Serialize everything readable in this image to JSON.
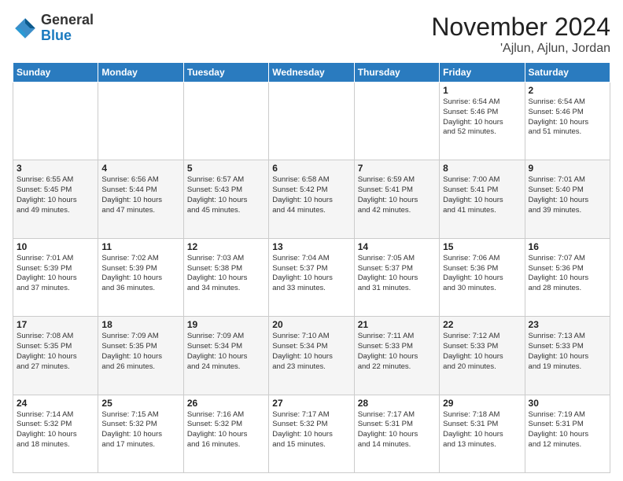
{
  "logo": {
    "general": "General",
    "blue": "Blue"
  },
  "header": {
    "title": "November 2024",
    "subtitle": "'Ajlun, Ajlun, Jordan"
  },
  "days_of_week": [
    "Sunday",
    "Monday",
    "Tuesday",
    "Wednesday",
    "Thursday",
    "Friday",
    "Saturday"
  ],
  "weeks": [
    [
      {
        "day": "",
        "info": ""
      },
      {
        "day": "",
        "info": ""
      },
      {
        "day": "",
        "info": ""
      },
      {
        "day": "",
        "info": ""
      },
      {
        "day": "",
        "info": ""
      },
      {
        "day": "1",
        "info": "Sunrise: 6:54 AM\nSunset: 5:46 PM\nDaylight: 10 hours\nand 52 minutes."
      },
      {
        "day": "2",
        "info": "Sunrise: 6:54 AM\nSunset: 5:46 PM\nDaylight: 10 hours\nand 51 minutes."
      }
    ],
    [
      {
        "day": "3",
        "info": "Sunrise: 6:55 AM\nSunset: 5:45 PM\nDaylight: 10 hours\nand 49 minutes."
      },
      {
        "day": "4",
        "info": "Sunrise: 6:56 AM\nSunset: 5:44 PM\nDaylight: 10 hours\nand 47 minutes."
      },
      {
        "day": "5",
        "info": "Sunrise: 6:57 AM\nSunset: 5:43 PM\nDaylight: 10 hours\nand 45 minutes."
      },
      {
        "day": "6",
        "info": "Sunrise: 6:58 AM\nSunset: 5:42 PM\nDaylight: 10 hours\nand 44 minutes."
      },
      {
        "day": "7",
        "info": "Sunrise: 6:59 AM\nSunset: 5:41 PM\nDaylight: 10 hours\nand 42 minutes."
      },
      {
        "day": "8",
        "info": "Sunrise: 7:00 AM\nSunset: 5:41 PM\nDaylight: 10 hours\nand 41 minutes."
      },
      {
        "day": "9",
        "info": "Sunrise: 7:01 AM\nSunset: 5:40 PM\nDaylight: 10 hours\nand 39 minutes."
      }
    ],
    [
      {
        "day": "10",
        "info": "Sunrise: 7:01 AM\nSunset: 5:39 PM\nDaylight: 10 hours\nand 37 minutes."
      },
      {
        "day": "11",
        "info": "Sunrise: 7:02 AM\nSunset: 5:39 PM\nDaylight: 10 hours\nand 36 minutes."
      },
      {
        "day": "12",
        "info": "Sunrise: 7:03 AM\nSunset: 5:38 PM\nDaylight: 10 hours\nand 34 minutes."
      },
      {
        "day": "13",
        "info": "Sunrise: 7:04 AM\nSunset: 5:37 PM\nDaylight: 10 hours\nand 33 minutes."
      },
      {
        "day": "14",
        "info": "Sunrise: 7:05 AM\nSunset: 5:37 PM\nDaylight: 10 hours\nand 31 minutes."
      },
      {
        "day": "15",
        "info": "Sunrise: 7:06 AM\nSunset: 5:36 PM\nDaylight: 10 hours\nand 30 minutes."
      },
      {
        "day": "16",
        "info": "Sunrise: 7:07 AM\nSunset: 5:36 PM\nDaylight: 10 hours\nand 28 minutes."
      }
    ],
    [
      {
        "day": "17",
        "info": "Sunrise: 7:08 AM\nSunset: 5:35 PM\nDaylight: 10 hours\nand 27 minutes."
      },
      {
        "day": "18",
        "info": "Sunrise: 7:09 AM\nSunset: 5:35 PM\nDaylight: 10 hours\nand 26 minutes."
      },
      {
        "day": "19",
        "info": "Sunrise: 7:09 AM\nSunset: 5:34 PM\nDaylight: 10 hours\nand 24 minutes."
      },
      {
        "day": "20",
        "info": "Sunrise: 7:10 AM\nSunset: 5:34 PM\nDaylight: 10 hours\nand 23 minutes."
      },
      {
        "day": "21",
        "info": "Sunrise: 7:11 AM\nSunset: 5:33 PM\nDaylight: 10 hours\nand 22 minutes."
      },
      {
        "day": "22",
        "info": "Sunrise: 7:12 AM\nSunset: 5:33 PM\nDaylight: 10 hours\nand 20 minutes."
      },
      {
        "day": "23",
        "info": "Sunrise: 7:13 AM\nSunset: 5:33 PM\nDaylight: 10 hours\nand 19 minutes."
      }
    ],
    [
      {
        "day": "24",
        "info": "Sunrise: 7:14 AM\nSunset: 5:32 PM\nDaylight: 10 hours\nand 18 minutes."
      },
      {
        "day": "25",
        "info": "Sunrise: 7:15 AM\nSunset: 5:32 PM\nDaylight: 10 hours\nand 17 minutes."
      },
      {
        "day": "26",
        "info": "Sunrise: 7:16 AM\nSunset: 5:32 PM\nDaylight: 10 hours\nand 16 minutes."
      },
      {
        "day": "27",
        "info": "Sunrise: 7:17 AM\nSunset: 5:32 PM\nDaylight: 10 hours\nand 15 minutes."
      },
      {
        "day": "28",
        "info": "Sunrise: 7:17 AM\nSunset: 5:31 PM\nDaylight: 10 hours\nand 14 minutes."
      },
      {
        "day": "29",
        "info": "Sunrise: 7:18 AM\nSunset: 5:31 PM\nDaylight: 10 hours\nand 13 minutes."
      },
      {
        "day": "30",
        "info": "Sunrise: 7:19 AM\nSunset: 5:31 PM\nDaylight: 10 hours\nand 12 minutes."
      }
    ]
  ]
}
